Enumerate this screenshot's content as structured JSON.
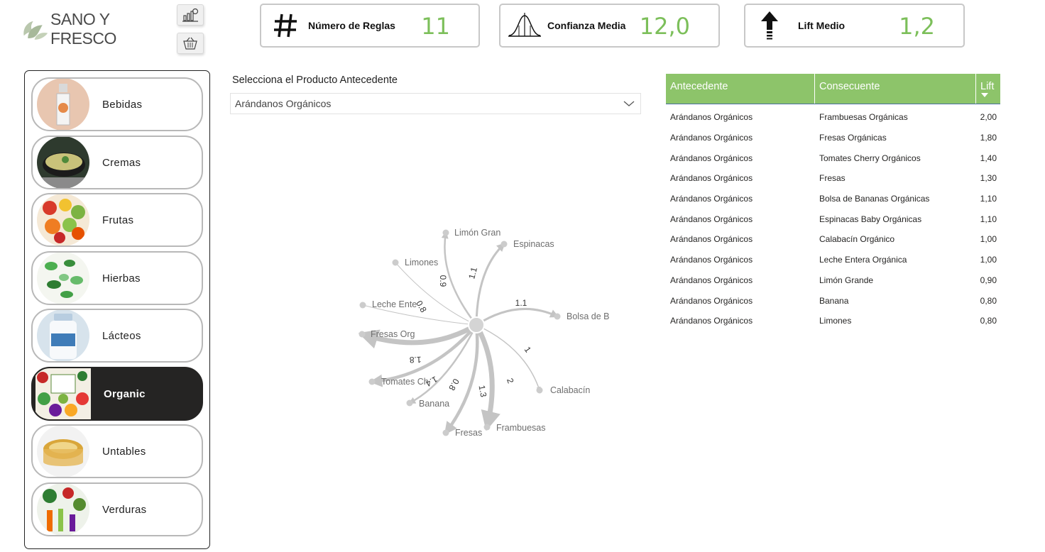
{
  "brand": {
    "name": "SANO Y FRESCO"
  },
  "kpis": [
    {
      "label": "Número de Reglas",
      "value": "11",
      "icon": "hash-icon"
    },
    {
      "label": "Confianza Media",
      "value": "12,0",
      "icon": "bell-curve-icon"
    },
    {
      "label": "Lift Medio",
      "value": "1,2",
      "icon": "up-arrow-icon"
    }
  ],
  "categories": [
    {
      "label": "Bebidas",
      "active": false
    },
    {
      "label": "Cremas",
      "active": false
    },
    {
      "label": "Frutas",
      "active": false
    },
    {
      "label": "Hierbas",
      "active": false
    },
    {
      "label": "Lácteos",
      "active": false
    },
    {
      "label": "Organic",
      "active": true
    },
    {
      "label": "Untables",
      "active": false
    },
    {
      "label": "Verduras",
      "active": false
    }
  ],
  "slicer": {
    "title": "Selecciona el Producto Antecedente",
    "value": "Arándanos Orgánicos"
  },
  "network": {
    "nodes": [
      {
        "label": "Limón Gran",
        "edge": "0.9"
      },
      {
        "label": "Espinacas",
        "edge": "1.1"
      },
      {
        "label": "Limones",
        "edge": ""
      },
      {
        "label": "Bolsa de B",
        "edge": "1.1"
      },
      {
        "label": "Leche Ente",
        "edge": "0.8"
      },
      {
        "label": "Fresas Org",
        "edge": "1.8"
      },
      {
        "label": "Calabacín",
        "edge": "1"
      },
      {
        "label": "Tomates Ch",
        "edge": "1.4"
      },
      {
        "label": "Banana",
        "edge": "0.8"
      },
      {
        "label": "Fresas",
        "edge": "1.3"
      },
      {
        "label": "Frambuesas",
        "edge": "2"
      }
    ]
  },
  "table": {
    "headers": [
      "Antecedente",
      "Consecuente",
      "Lift"
    ],
    "rows": [
      [
        "Arándanos Orgánicos",
        "Frambuesas Orgánicas",
        "2,00"
      ],
      [
        "Arándanos Orgánicos",
        "Fresas Orgánicas",
        "1,80"
      ],
      [
        "Arándanos Orgánicos",
        "Tomates Cherry Orgánicos",
        "1,40"
      ],
      [
        "Arándanos Orgánicos",
        "Fresas",
        "1,30"
      ],
      [
        "Arándanos Orgánicos",
        "Bolsa de Bananas Orgánicas",
        "1,10"
      ],
      [
        "Arándanos Orgánicos",
        "Espinacas Baby Orgánicas",
        "1,10"
      ],
      [
        "Arándanos Orgánicos",
        "Calabacín Orgánico",
        "1,00"
      ],
      [
        "Arándanos Orgánicos",
        "Leche Entera Orgánica",
        "1,00"
      ],
      [
        "Arándanos Orgánicos",
        "Limón Grande",
        "0,90"
      ],
      [
        "Arándanos Orgánicos",
        "Banana",
        "0,80"
      ],
      [
        "Arándanos Orgánicos",
        "Limones",
        "0,80"
      ]
    ]
  },
  "colors": {
    "accent": "#8dc46a",
    "kpi_value": "#7cbf5a",
    "active_item": "#252423"
  }
}
